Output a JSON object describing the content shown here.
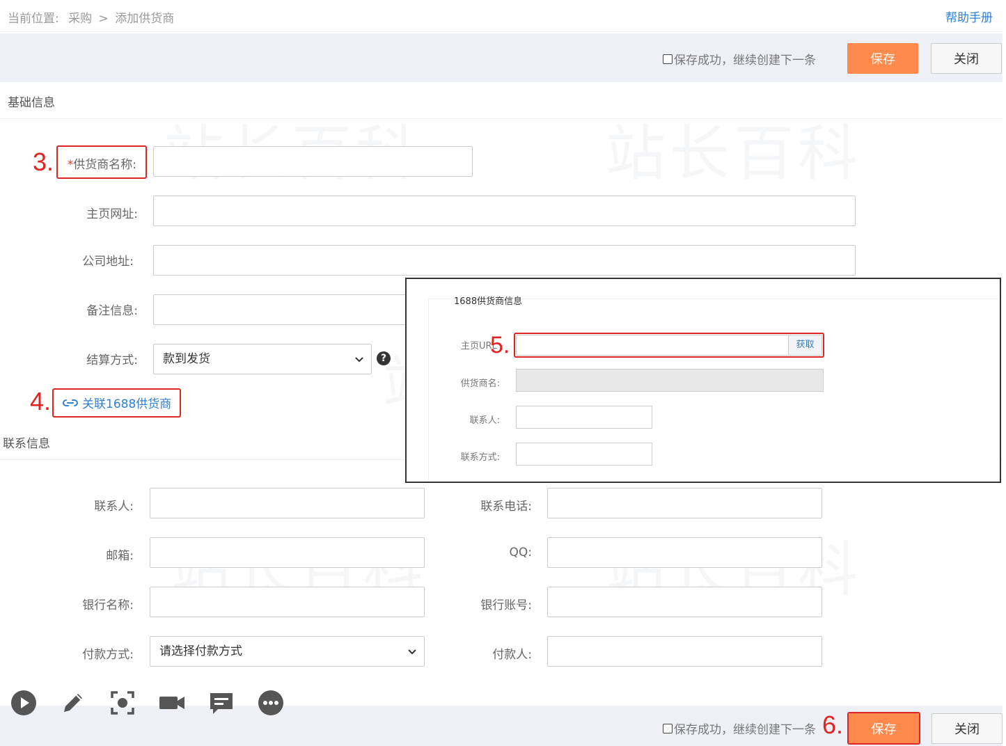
{
  "breadcrumb": {
    "prefix": "当前位置:",
    "level1": "采购",
    "separator": ">",
    "level2": "添加供货商"
  },
  "help": {
    "label": "帮助手册"
  },
  "top_actions": {
    "continue_label": "保存成功，继续创建下一条",
    "save_label": "保存",
    "close_label": "关闭"
  },
  "bottom_actions": {
    "continue_label": "保存成功，继续创建下一条",
    "save_label": "保存",
    "close_label": "关闭"
  },
  "basic_info": {
    "title": "基础信息",
    "supplier_name": {
      "required_mark": "*",
      "label": "供货商名称:",
      "value": ""
    },
    "homepage": {
      "label": "主页网址:",
      "value": ""
    },
    "address": {
      "label": "公司地址:",
      "value": ""
    },
    "remarks": {
      "label": "备注信息:",
      "value": ""
    },
    "settlement": {
      "label": "结算方式:",
      "selected": "款到发货"
    },
    "link_1688": "关联1688供货商"
  },
  "contact_info": {
    "title": "联系信息",
    "contact_person": {
      "label": "联系人:",
      "value": ""
    },
    "contact_phone": {
      "label": "联系电话:",
      "value": ""
    },
    "email": {
      "label": "邮箱:",
      "value": ""
    },
    "qq": {
      "label": "QQ:",
      "value": ""
    },
    "bank_name": {
      "label": "银行名称:",
      "value": ""
    },
    "bank_account": {
      "label": "银行账号:",
      "value": ""
    },
    "payment_method": {
      "label": "付款方式:",
      "selected": "请选择付款方式"
    },
    "payer": {
      "label": "付款人:",
      "value": ""
    }
  },
  "popup_1688": {
    "title": "1688供货商信息",
    "homepage_url": {
      "label": "主页URL",
      "value": "",
      "fetch_label": "获取"
    },
    "supplier_name": {
      "label": "供货商名:",
      "value": ""
    },
    "contact_person": {
      "label": "联系人:",
      "value": ""
    },
    "contact_method": {
      "label": "联系方式:",
      "value": ""
    }
  },
  "annotations": {
    "step3": "3.",
    "step4": "4.",
    "step5": "5.",
    "step6": "6."
  },
  "watermark": "站长百科",
  "toolbar_icons": [
    "play-icon",
    "pencil-icon",
    "screenshot-icon",
    "video-camera-icon",
    "comment-icon",
    "more-icon"
  ],
  "colors": {
    "accent": "#ff8a4c",
    "link": "#2f7fd5",
    "annotation_red": "#e02424",
    "bar_bg": "#eef0f6"
  }
}
